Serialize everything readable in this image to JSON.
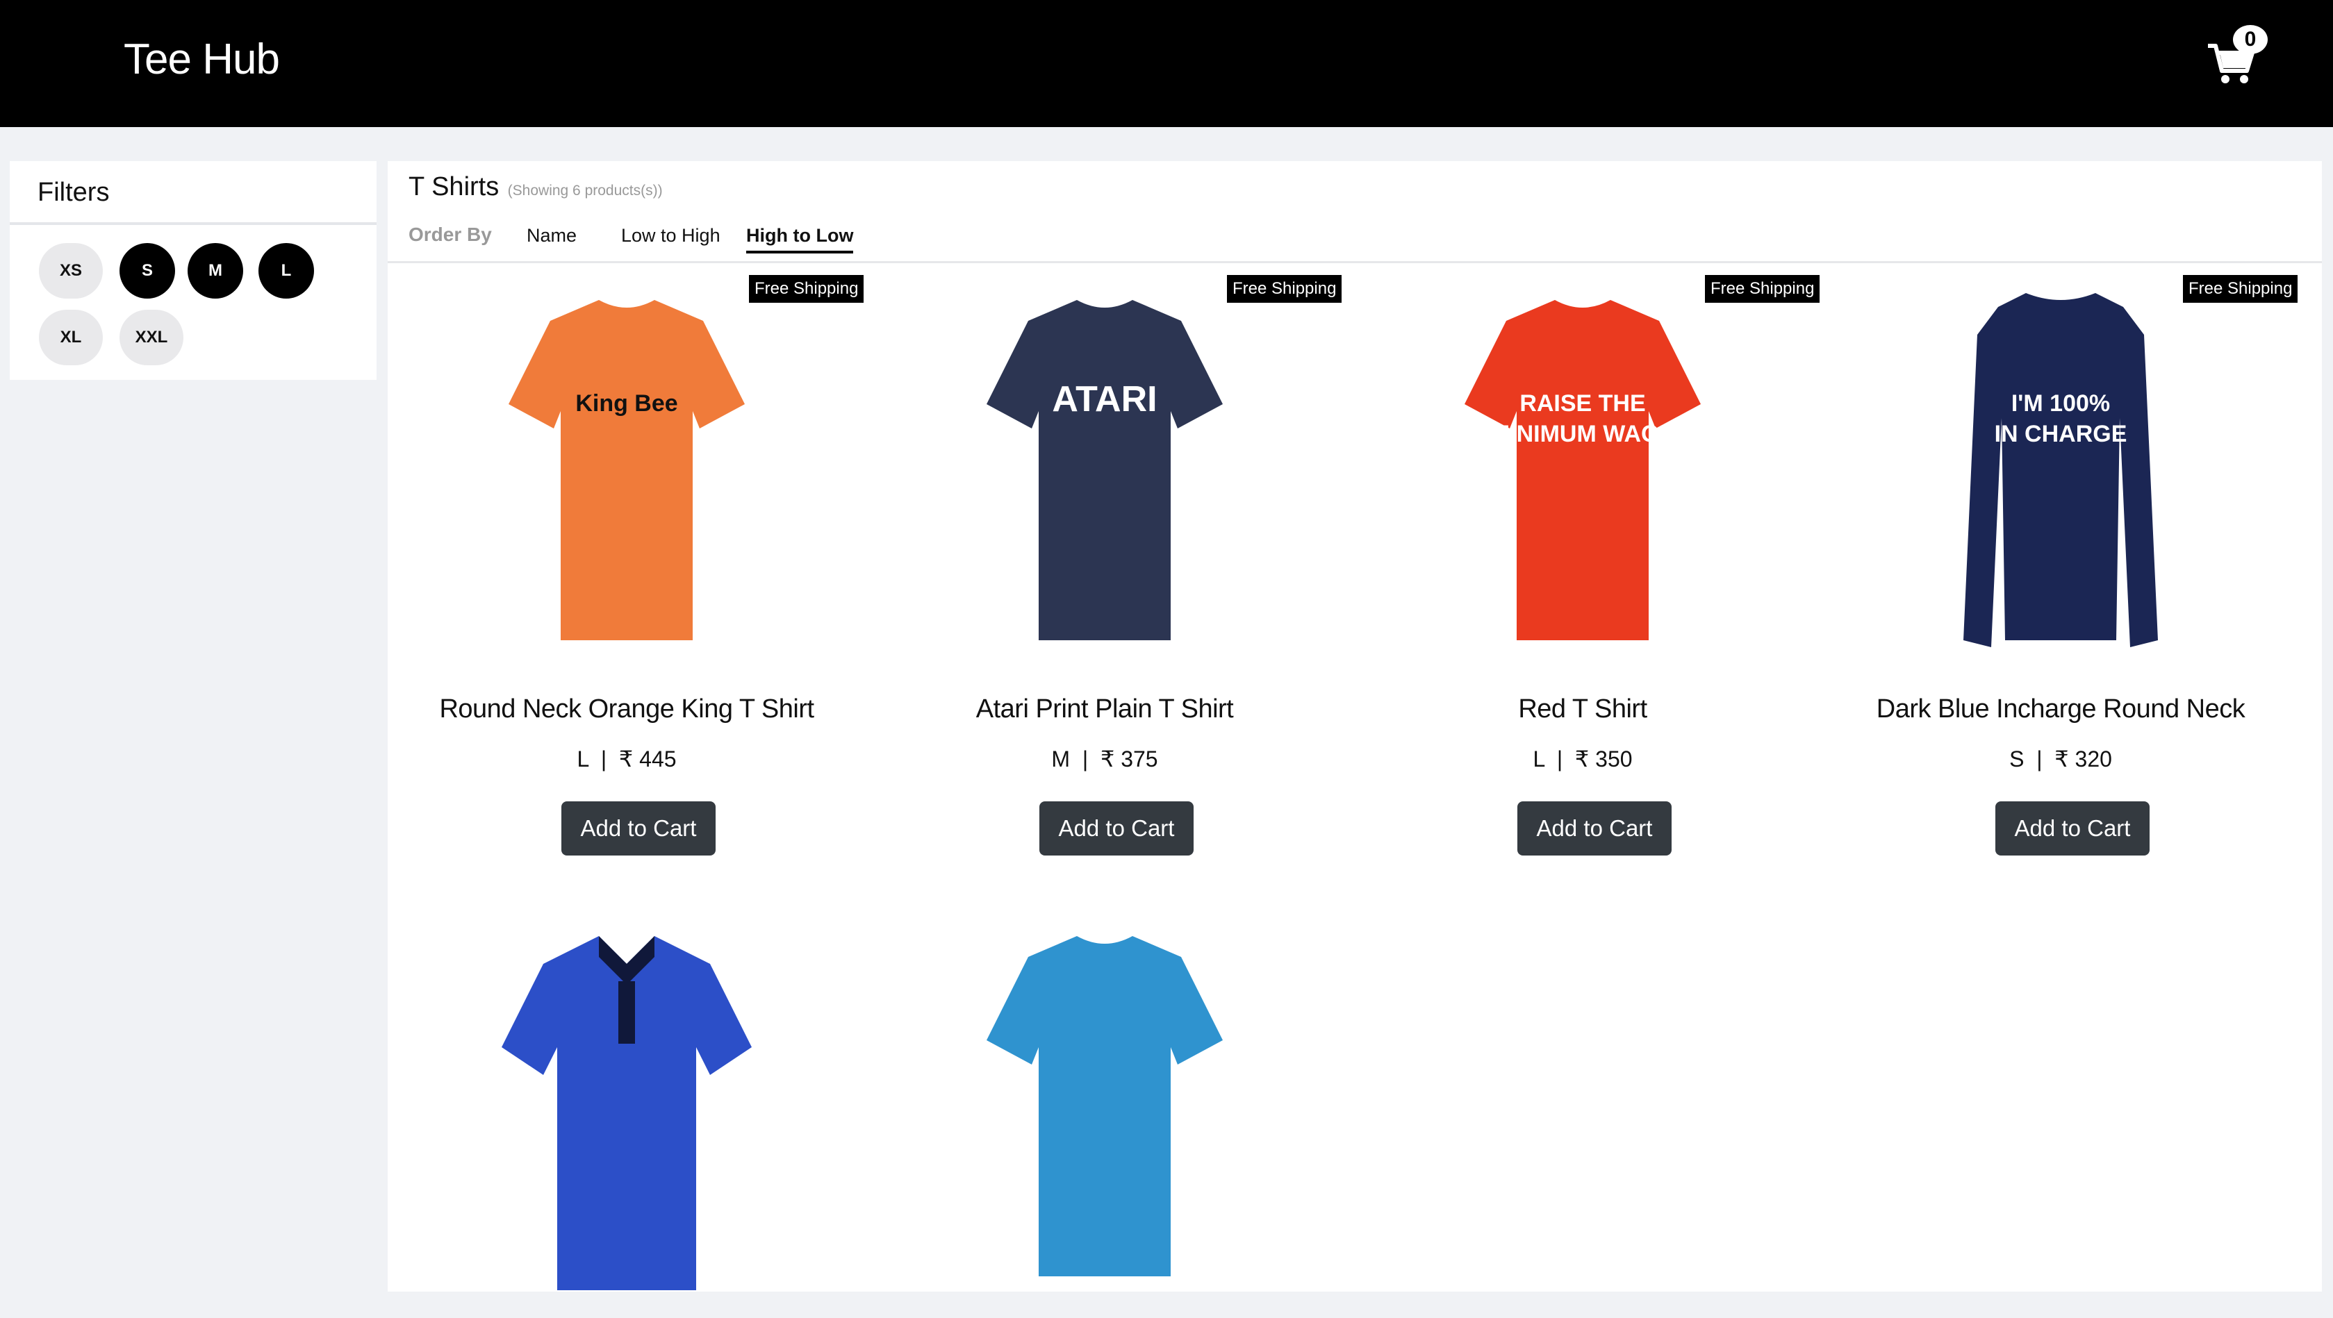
{
  "header": {
    "brand": "Tee Hub",
    "cart_count": "0",
    "cart_icon": "shopping-cart-icon"
  },
  "filters": {
    "title": "Filters",
    "sizes": [
      {
        "label": "XS",
        "selected": false
      },
      {
        "label": "S",
        "selected": true
      },
      {
        "label": "M",
        "selected": true
      },
      {
        "label": "L",
        "selected": true
      },
      {
        "label": "XL",
        "selected": false
      },
      {
        "label": "XXL",
        "selected": false
      }
    ]
  },
  "catalog": {
    "title": "T Shirts",
    "count_note": "(Showing 6 products(s))",
    "order_label": "Order By",
    "sort_options": [
      "Name",
      "Low to High",
      "High to Low"
    ],
    "active_sort": "High to Low"
  },
  "products": [
    {
      "name": "Round Neck Orange King T Shirt",
      "meta": "L  |  ₹ 445",
      "badge": "Free Shipping",
      "button": "Add to Cart",
      "color": "#f07b3a",
      "art": "King Bee"
    },
    {
      "name": "Atari Print Plain T Shirt",
      "meta": "M  |  ₹ 375",
      "badge": "Free Shipping",
      "button": "Add to Cart",
      "color": "#2c3552",
      "art": "ATARI"
    },
    {
      "name": "Red T Shirt",
      "meta": "L  |  ₹ 350",
      "badge": "Free Shipping",
      "button": "Add to Cart",
      "color": "#ea3a1f",
      "art": "RAISE THE MINIMUM WAGE"
    },
    {
      "name": "Dark Blue Incharge Round Neck",
      "meta": "S  |  ₹ 320",
      "badge": "Free Shipping",
      "button": "Add to Cart",
      "color": "#1b2654",
      "art": "I'M 100% IN CHARGE"
    },
    {
      "name": "",
      "meta": "",
      "badge": "",
      "button": "",
      "color": "#2c4fc8",
      "art": ""
    },
    {
      "name": "",
      "meta": "",
      "badge": "",
      "button": "",
      "color": "#2f93cf",
      "art": ""
    }
  ]
}
